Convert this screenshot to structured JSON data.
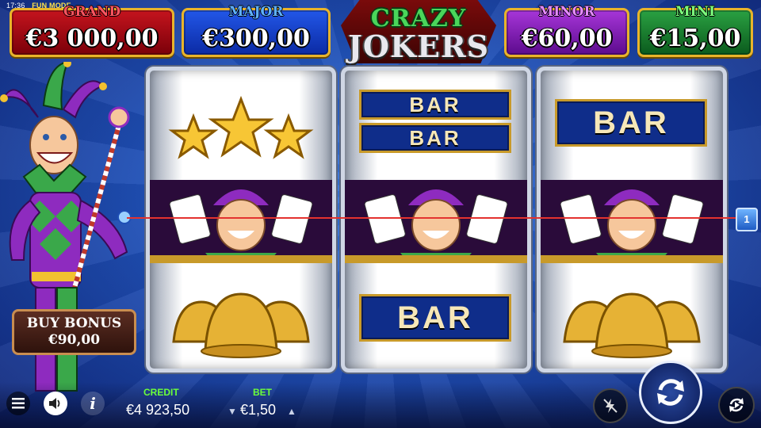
{
  "status": {
    "time": "17:36",
    "mode": "FUN MODE"
  },
  "jackpots": [
    {
      "label": "GRAND",
      "value": "€3 000,00"
    },
    {
      "label": "MAJOR",
      "value": "€300,00"
    },
    {
      "label": "MINOR",
      "value": "€60,00"
    },
    {
      "label": "MINI",
      "value": "€15,00"
    }
  ],
  "logo": {
    "line1": "CRAZY",
    "line2": "JOKERS"
  },
  "reels": [
    {
      "symbols": [
        "three-stars",
        "joker",
        "bells"
      ]
    },
    {
      "symbols": [
        "double-bar",
        "joker",
        "single-bar"
      ]
    },
    {
      "symbols": [
        "single-bar",
        "joker",
        "bells"
      ]
    }
  ],
  "bar_text": "BAR",
  "payline": {
    "number": "1",
    "color": "#e3322f"
  },
  "buy_bonus": {
    "label": "BUY BONUS",
    "price": "€90,00"
  },
  "credit": {
    "label": "CREDIT",
    "value": "€4 923,50"
  },
  "bet": {
    "label": "BET",
    "value": "€1,50"
  },
  "icons": {
    "menu": "hamburger-icon",
    "sound": "speaker-icon",
    "info": "info-icon",
    "turbo": "lightning-disabled-icon",
    "spin": "refresh-arrows-icon",
    "autoplay": "autoplay-icon"
  },
  "info_glyph": "i"
}
